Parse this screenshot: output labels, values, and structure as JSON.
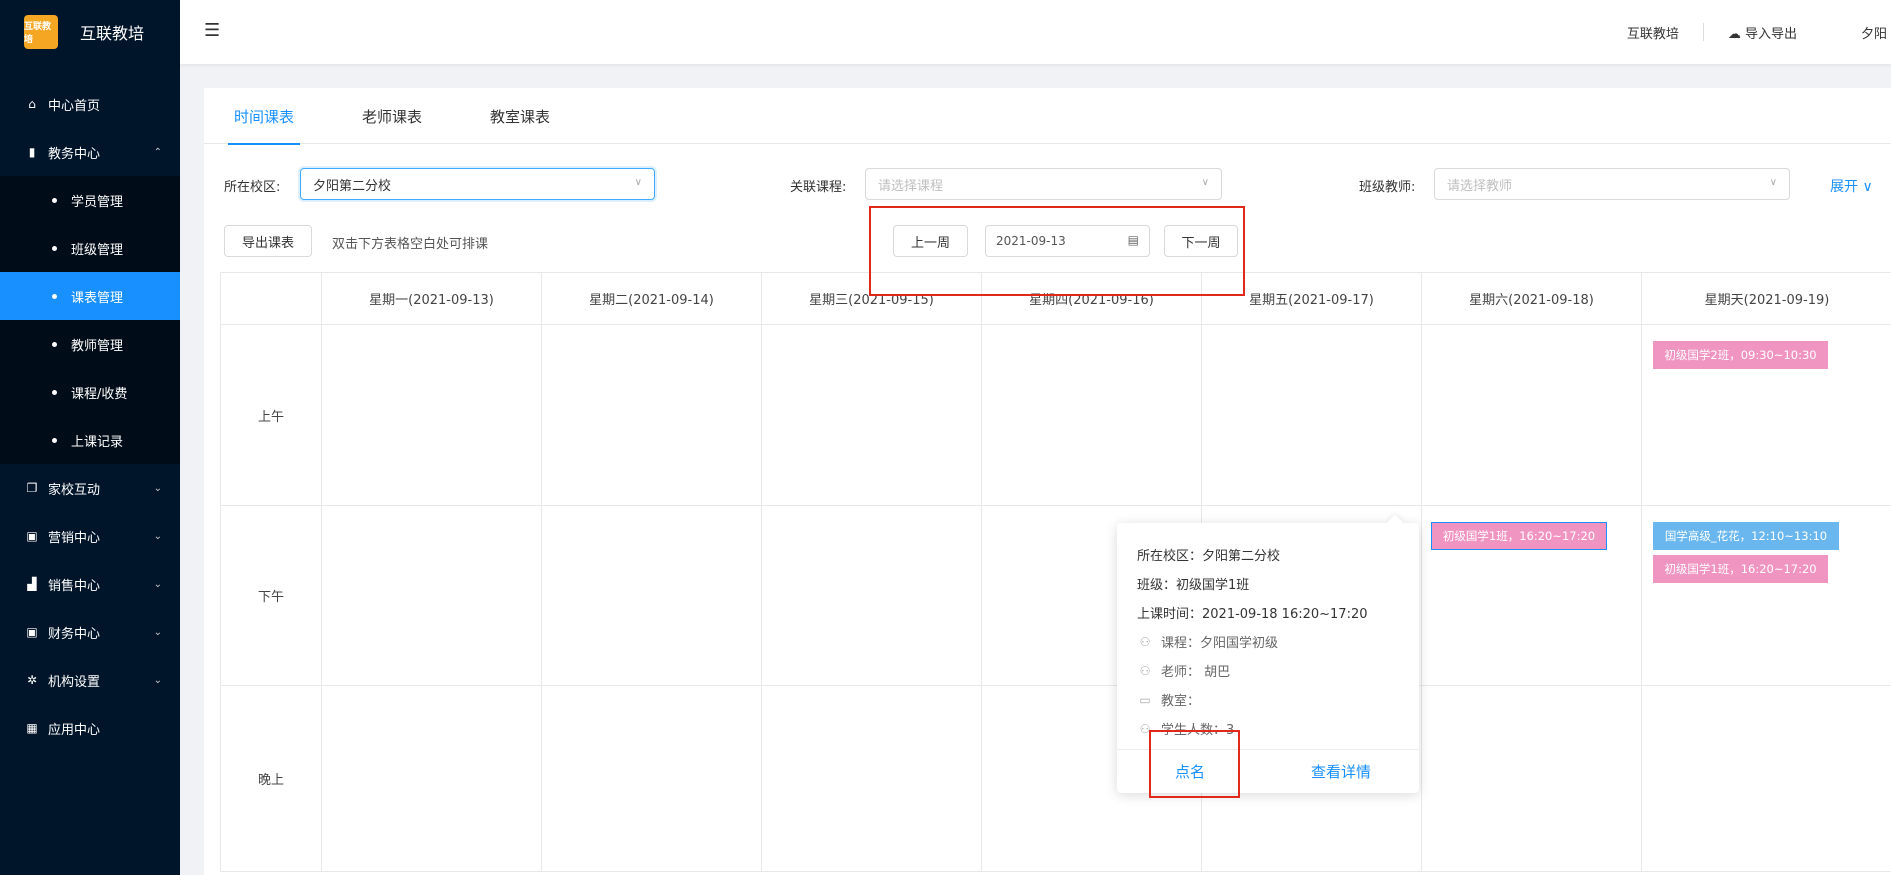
{
  "brand": {
    "logo_text": "互联教培",
    "title": "互联教培"
  },
  "sidebar": {
    "items": [
      {
        "label": "中心首页",
        "icon": "home-icon",
        "glyph": "⌂"
      },
      {
        "label": "教务中心",
        "icon": "book-icon",
        "glyph": "▮",
        "chev": "⌃"
      },
      {
        "label": "家校互动",
        "icon": "copy-icon",
        "glyph": "❐",
        "chev": "⌄"
      },
      {
        "label": "营销中心",
        "icon": "bag-icon",
        "glyph": "▣",
        "chev": "⌄"
      },
      {
        "label": "销售中心",
        "icon": "chart-icon",
        "glyph": "▟",
        "chev": "⌄"
      },
      {
        "label": "财务中心",
        "icon": "wallet-icon",
        "glyph": "▣",
        "chev": "⌄"
      },
      {
        "label": "机构设置",
        "icon": "gear-icon",
        "glyph": "✲",
        "chev": "⌄"
      },
      {
        "label": "应用中心",
        "icon": "apps-icon",
        "glyph": "▦"
      }
    ],
    "sub_items": [
      {
        "label": "学员管理"
      },
      {
        "label": "班级管理"
      },
      {
        "label": "课表管理"
      },
      {
        "label": "教师管理"
      },
      {
        "label": "课程/收费"
      },
      {
        "label": "上课记录"
      }
    ]
  },
  "header": {
    "fold_glyph": "☰",
    "link_brand": "互联教培",
    "import_export": "导入导出",
    "cloud_glyph": "☁",
    "user": "夕阳"
  },
  "tabs": [
    {
      "label": "时间课表"
    },
    {
      "label": "老师课表"
    },
    {
      "label": "教室课表"
    }
  ],
  "filters": {
    "campus_label": "所在校区:",
    "campus_value": "夕阳第二分校",
    "course_label": "关联课程:",
    "course_placeholder": "请选择课程",
    "teacher_label": "班级教师:",
    "teacher_placeholder": "请选择教师",
    "expand": "展开 ∨",
    "arrow": "∨"
  },
  "toolbar": {
    "export": "导出课表",
    "hint": "双击下方表格空白处可排课",
    "prev_week": "上一周",
    "date": "2021-09-13",
    "calendar_glyph": "▤",
    "next_week": "下一周"
  },
  "schedule": {
    "days": [
      "星期一(2021-09-13)",
      "星期二(2021-09-14)",
      "星期三(2021-09-15)",
      "星期四(2021-09-16)",
      "星期五(2021-09-17)",
      "星期六(2021-09-18)",
      "星期天(2021-09-19)"
    ],
    "periods": [
      "上午",
      "下午",
      "晚上"
    ],
    "courses": [
      {
        "label": "初级国学2班，09:30~10:30",
        "color": "#f094c1"
      },
      {
        "label": "初级国学1班，16:20~17:20",
        "color": "#f094c1"
      },
      {
        "label": "国学高级_花花，12:10~13:10",
        "color": "#69b7ee"
      },
      {
        "label": "初级国学1班，16:20~17:20",
        "color": "#f094c1"
      }
    ]
  },
  "popover": {
    "campus": "所在校区：夕阳第二分校",
    "class": "班级：初级国学1班",
    "time": "上课时间：2021-09-18 16:20~17:20",
    "course": "课程：夕阳国学初级",
    "teacher": "老师： 胡巴",
    "room": "教室：",
    "students": "学生人数：3",
    "user_glyph": "⚇",
    "room_glyph": "▭",
    "rollcall": "点名",
    "details": "查看详情"
  },
  "colors": {
    "accent": "#1890ff",
    "sidebar_bg": "#001529",
    "highlight": "#e0281b"
  }
}
